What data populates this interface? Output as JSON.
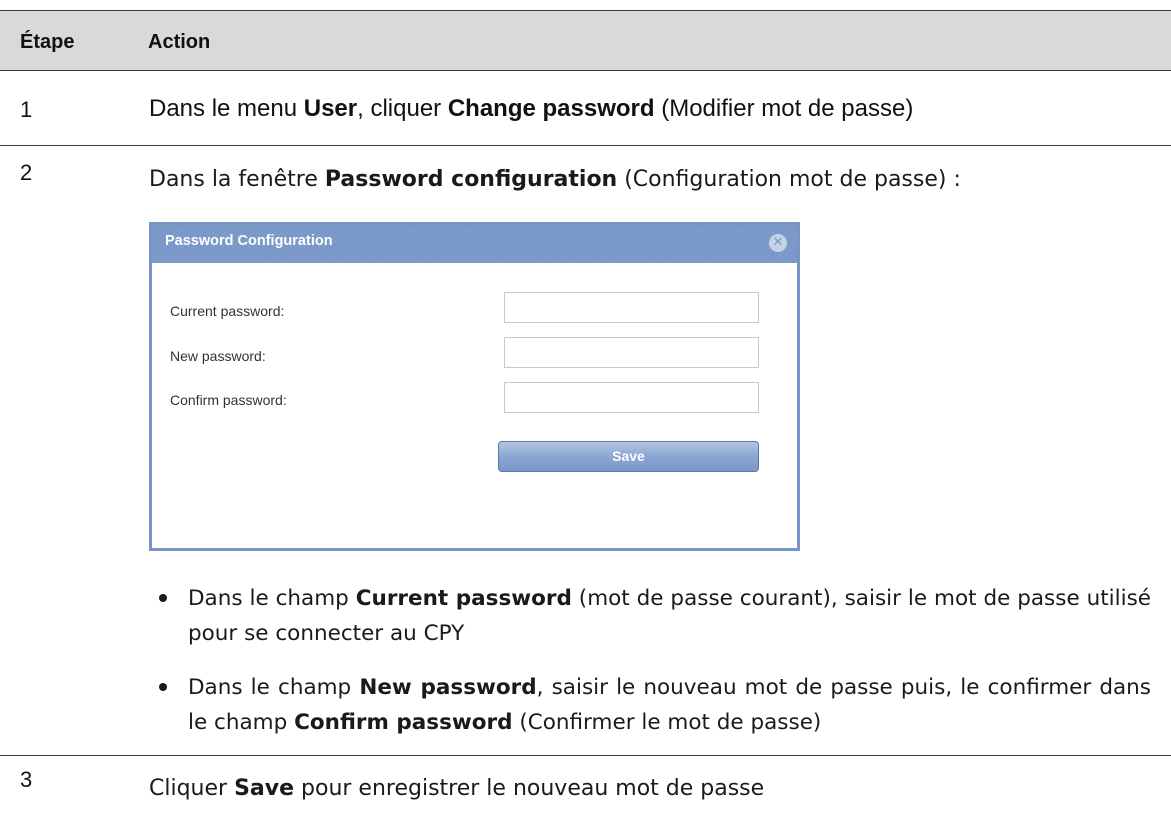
{
  "table": {
    "headers": {
      "step": "Étape",
      "action": "Action"
    },
    "rows": [
      {
        "step": "1",
        "text": [
          "Dans le menu ",
          "User",
          ", cliquer ",
          "Change password",
          " (Modifier mot de passe)"
        ]
      },
      {
        "step": "2",
        "text": [
          "Dans la fenêtre ",
          "Password configuration",
          " (Configuration mot de passe) :"
        ],
        "bullets": [
          [
            "Dans le champ ",
            "Current password",
            " (mot de passe courant), saisir le mot de passe utilisé pour se connecter au CPY"
          ],
          [
            "Dans le champ ",
            "New password",
            ", saisir le nouveau mot de passe puis, le confirmer dans le champ ",
            "Confirm password",
            " (Confirmer le mot de passe)"
          ]
        ]
      },
      {
        "step": "3",
        "text": [
          "Cliquer ",
          "Save",
          " pour enregistrer le nouveau mot de passe"
        ]
      }
    ]
  },
  "dialog": {
    "title": "Password Configuration",
    "close_icon": "close-circle-icon",
    "fields": [
      {
        "label": "Current password:",
        "value": ""
      },
      {
        "label": "New password:",
        "value": ""
      },
      {
        "label": "Confirm password:",
        "value": ""
      }
    ],
    "save_label": "Save",
    "colors": {
      "title_bar": "#7896c7",
      "border": "#7995c3",
      "button": "#8aa6d2"
    }
  }
}
